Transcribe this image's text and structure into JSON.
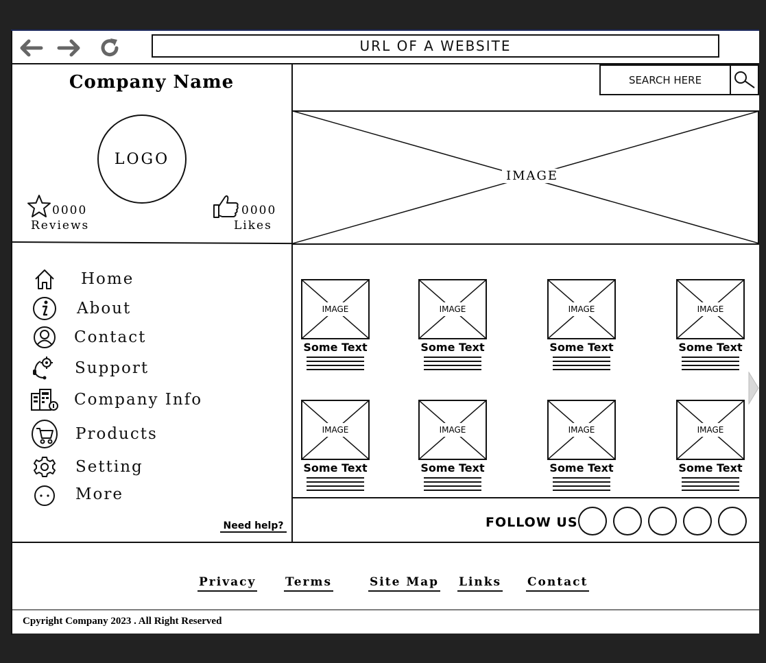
{
  "browser": {
    "url_text": "URL OF A WEBSITE",
    "back_icon": "arrow-left-icon",
    "forward_icon": "arrow-right-icon",
    "reload_icon": "reload-icon"
  },
  "sidebar": {
    "company_name": "Company Name",
    "logo_text": "LOGO",
    "reviews": {
      "count": "0000",
      "label": "Reviews",
      "icon": "star-icon"
    },
    "likes": {
      "count": "0000",
      "label": "Likes",
      "icon": "thumbs-up-icon"
    },
    "menu": [
      {
        "label": "Home",
        "icon": "home-icon"
      },
      {
        "label": "About",
        "icon": "info-icon"
      },
      {
        "label": "Contact",
        "icon": "user-icon"
      },
      {
        "label": "Support",
        "icon": "support-icon"
      },
      {
        "label": "Company Info",
        "icon": "building-icon"
      },
      {
        "label": "Products",
        "icon": "cart-icon"
      },
      {
        "label": "Setting",
        "icon": "gear-icon"
      },
      {
        "label": "More",
        "icon": "more-icon"
      }
    ],
    "help_text": "Need help?"
  },
  "header": {
    "search_placeholder": "SEARCH HERE",
    "search_icon": "search-icon"
  },
  "hero": {
    "label": "IMAGE"
  },
  "products": [
    {
      "image_label": "IMAGE",
      "title": "Some Text"
    },
    {
      "image_label": "IMAGE",
      "title": "Some Text"
    },
    {
      "image_label": "IMAGE",
      "title": "Some Text"
    },
    {
      "image_label": "IMAGE",
      "title": "Some Text"
    },
    {
      "image_label": "IMAGE",
      "title": "Some Text"
    },
    {
      "image_label": "IMAGE",
      "title": "Some Text"
    },
    {
      "image_label": "IMAGE",
      "title": "Some Text"
    },
    {
      "image_label": "IMAGE",
      "title": "Some Text"
    }
  ],
  "follow": {
    "label": "FOLLOW US",
    "social_count": 5
  },
  "footer": {
    "links": [
      "Privacy",
      "Terms",
      "Site Map",
      "Links",
      "Contact"
    ],
    "copyright": "Cpyright Company 2023 . All Right Reserved"
  },
  "colors": {
    "frame_border": "#1e2a5e",
    "background": "#222222",
    "ink": "#111111"
  }
}
